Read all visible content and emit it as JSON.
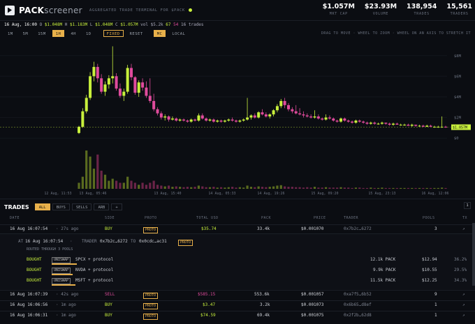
{
  "header": {
    "brand_bold": "PACK",
    "brand_light": "screener",
    "tagline": "AGGREGATED TRADE TERMINAL FOR $PACK",
    "stats": [
      {
        "value": "$1.057M",
        "label": "MKT CAP"
      },
      {
        "value": "$23.93M",
        "label": "VOLUME"
      },
      {
        "value": "138,954",
        "label": "TRADES"
      },
      {
        "value": "15,561",
        "label": "TRADERS"
      }
    ]
  },
  "ohlc": {
    "date": "16 Aug, 16:00",
    "o": "$1.048M",
    "h": "$1.183M",
    "l": "$1.048M",
    "c": "$1.057M",
    "vol": "vol $5.2k",
    "buys": "67",
    "sells": "54",
    "trades": "16 trades"
  },
  "toolbar": {
    "intervals": [
      "1M",
      "5M",
      "15M",
      "1H",
      "4H",
      "1D"
    ],
    "selected_interval": "1H",
    "fixed": "FIXED",
    "reset": "RESET",
    "mc": "MC",
    "local": "LOCAL",
    "hint": "DRAG TO MOVE · WHEEL TO ZOOM · WHEEL ON AN AXIS TO STRETCH IT"
  },
  "chart_data": {
    "type": "candlestick",
    "y_ticks": [
      "$8M",
      "$6M",
      "$4M",
      "$2M",
      "$0"
    ],
    "y_tick_values": [
      8,
      6,
      4,
      2,
      0
    ],
    "ylim": [
      -1.2,
      9.2
    ],
    "last_price_label": "$1.057M",
    "last_price": 1.06,
    "x_ticks": [
      "12 Aug, 11:53",
      "13 Aug, 05:46",
      "13 Aug, 15:40",
      "14 Aug, 05:33",
      "14 Aug, 19:26",
      "15 Aug, 09:20",
      "15 Aug, 23:13",
      "16 Aug, 12:06"
    ],
    "ohlc": [
      [
        0.5,
        1.2,
        0.4,
        1.1
      ],
      [
        1.1,
        2.9,
        1.0,
        2.6
      ],
      [
        2.6,
        4.2,
        2.4,
        3.9
      ],
      [
        3.9,
        6.4,
        3.7,
        6.0
      ],
      [
        6.0,
        7.4,
        5.5,
        6.9
      ],
      [
        6.9,
        7.2,
        5.4,
        5.8
      ],
      [
        5.8,
        6.2,
        4.3,
        4.5
      ],
      [
        4.5,
        5.5,
        4.1,
        5.2
      ],
      [
        5.2,
        6.1,
        4.8,
        5.8
      ],
      [
        5.8,
        8.9,
        5.3,
        6.0
      ],
      [
        6.0,
        6.3,
        4.6,
        4.8
      ],
      [
        4.8,
        5.3,
        3.9,
        4.1
      ],
      [
        4.1,
        4.8,
        3.6,
        4.5
      ],
      [
        4.5,
        7.1,
        4.3,
        6.8
      ],
      [
        6.8,
        7.2,
        5.6,
        5.9
      ],
      [
        5.9,
        6.0,
        4.2,
        4.4
      ],
      [
        4.4,
        5.6,
        4.0,
        5.4
      ],
      [
        5.4,
        5.8,
        4.6,
        4.9
      ],
      [
        4.9,
        5.5,
        3.9,
        4.1
      ],
      [
        4.1,
        5.8,
        3.4,
        3.6
      ],
      [
        3.6,
        4.3,
        2.6,
        2.8
      ],
      [
        2.8,
        3.0,
        2.2,
        2.4
      ],
      [
        2.4,
        2.6,
        1.8,
        2.0
      ],
      [
        2.0,
        2.3,
        1.7,
        2.1
      ],
      [
        2.1,
        2.2,
        1.6,
        1.8
      ],
      [
        1.8,
        2.1,
        1.7,
        1.9
      ],
      [
        1.9,
        2.0,
        1.6,
        1.7
      ],
      [
        1.7,
        1.9,
        1.6,
        1.8
      ],
      [
        1.8,
        1.9,
        1.6,
        1.7
      ],
      [
        1.7,
        1.8,
        1.5,
        1.6
      ],
      [
        1.6,
        1.9,
        1.5,
        1.8
      ],
      [
        1.8,
        1.9,
        1.6,
        1.7
      ],
      [
        1.7,
        2.4,
        1.6,
        2.2
      ],
      [
        2.2,
        2.4,
        1.8,
        1.9
      ],
      [
        1.9,
        2.0,
        1.6,
        1.7
      ],
      [
        1.7,
        1.9,
        1.6,
        1.8
      ],
      [
        1.8,
        1.9,
        1.5,
        1.6
      ],
      [
        1.6,
        1.8,
        1.5,
        1.7
      ],
      [
        1.7,
        1.8,
        1.5,
        1.6
      ],
      [
        1.6,
        1.8,
        1.5,
        1.7
      ],
      [
        1.7,
        1.9,
        1.6,
        1.8
      ],
      [
        1.8,
        2.0,
        1.6,
        1.7
      ],
      [
        1.7,
        1.8,
        1.5,
        1.6
      ],
      [
        1.6,
        1.8,
        1.5,
        1.7
      ],
      [
        1.7,
        1.9,
        1.6,
        1.8
      ],
      [
        1.8,
        3.9,
        1.7,
        2.0
      ],
      [
        2.0,
        2.3,
        1.8,
        2.2
      ],
      [
        2.2,
        2.4,
        1.9,
        2.0
      ],
      [
        2.0,
        2.6,
        1.9,
        2.5
      ],
      [
        2.5,
        2.8,
        2.2,
        2.3
      ],
      [
        2.3,
        2.5,
        2.0,
        2.1
      ],
      [
        2.1,
        2.4,
        1.9,
        2.3
      ],
      [
        2.3,
        2.8,
        2.1,
        2.7
      ],
      [
        2.7,
        3.3,
        2.5,
        3.1
      ],
      [
        3.1,
        3.8,
        2.9,
        3.6
      ],
      [
        3.6,
        3.9,
        2.9,
        3.2
      ],
      [
        3.2,
        3.4,
        2.6,
        2.8
      ],
      [
        2.8,
        3.0,
        2.4,
        2.6
      ],
      [
        2.6,
        3.2,
        2.3,
        2.4
      ],
      [
        2.4,
        2.9,
        2.2,
        2.3
      ],
      [
        2.3,
        2.6,
        2.0,
        2.2
      ],
      [
        2.2,
        2.4,
        2.0,
        2.1
      ],
      [
        2.1,
        2.3,
        1.9,
        2.0
      ],
      [
        2.0,
        2.7,
        1.9,
        2.1
      ],
      [
        2.1,
        2.3,
        1.8,
        1.9
      ],
      [
        1.9,
        2.0,
        1.7,
        1.8
      ],
      [
        1.8,
        2.3,
        1.7,
        2.0
      ],
      [
        2.0,
        2.2,
        1.8,
        1.9
      ],
      [
        1.9,
        2.0,
        1.6,
        1.7
      ],
      [
        1.7,
        1.8,
        1.5,
        1.6
      ],
      [
        1.6,
        2.0,
        1.5,
        1.9
      ],
      [
        1.9,
        2.0,
        1.6,
        1.7
      ],
      [
        1.7,
        1.8,
        1.5,
        1.6
      ],
      [
        1.6,
        1.7,
        1.4,
        1.5
      ],
      [
        1.5,
        1.8,
        1.4,
        1.7
      ],
      [
        1.7,
        1.8,
        1.5,
        1.6
      ],
      [
        1.6,
        1.7,
        1.4,
        1.5
      ],
      [
        1.5,
        1.6,
        1.3,
        1.4
      ],
      [
        1.4,
        1.6,
        1.3,
        1.5
      ],
      [
        1.5,
        1.6,
        1.3,
        1.4
      ],
      [
        1.4,
        1.5,
        1.3,
        1.4
      ],
      [
        1.4,
        1.6,
        1.3,
        1.5
      ],
      [
        1.5,
        1.5,
        1.3,
        1.4
      ],
      [
        1.4,
        1.5,
        1.2,
        1.3
      ],
      [
        1.3,
        1.5,
        1.2,
        1.4
      ],
      [
        1.4,
        1.5,
        1.3,
        1.3
      ],
      [
        1.3,
        1.4,
        1.2,
        1.3
      ],
      [
        1.3,
        1.4,
        1.2,
        1.3
      ],
      [
        1.3,
        1.4,
        1.2,
        1.2
      ],
      [
        1.2,
        1.4,
        1.1,
        1.3
      ],
      [
        1.3,
        1.3,
        1.1,
        1.2
      ],
      [
        1.2,
        1.3,
        1.1,
        1.2
      ],
      [
        1.2,
        1.3,
        1.1,
        1.1
      ],
      [
        1.1,
        1.3,
        1.1,
        1.2
      ],
      [
        1.2,
        1.3,
        1.1,
        1.1
      ],
      [
        1.1,
        1.2,
        1.0,
        1.1
      ],
      [
        1.1,
        1.2,
        1.0,
        1.1
      ],
      [
        1.1,
        2.1,
        1.0,
        1.1
      ],
      [
        1.1,
        1.2,
        1.0,
        1.06
      ]
    ],
    "volume": [
      1.5,
      3.0,
      9.5,
      8.0,
      5.0,
      8.5,
      4.5,
      3.5,
      2.0,
      2.5,
      2.0,
      1.5,
      1.5,
      3.0,
      2.0,
      1.5,
      1.0,
      1.5,
      1.0,
      1.5,
      2.0,
      1.0,
      0.8,
      0.6,
      0.8,
      0.5,
      0.6,
      0.5,
      0.4,
      0.5,
      0.4,
      0.5,
      0.8,
      0.6,
      0.4,
      0.4,
      0.5,
      0.3,
      0.4,
      0.3,
      0.4,
      0.5,
      0.3,
      0.4,
      0.3,
      0.8,
      0.5,
      0.4,
      0.6,
      0.5,
      0.4,
      0.5,
      0.6,
      0.8,
      0.9,
      0.6,
      0.5,
      0.5,
      0.4,
      0.4,
      0.3,
      0.4,
      0.3,
      0.5,
      0.3,
      0.3,
      0.4,
      0.3,
      0.3,
      0.3,
      0.4,
      0.3,
      0.3,
      0.2,
      0.3,
      0.3,
      0.2,
      0.2,
      0.3,
      0.2,
      0.2,
      0.3,
      0.2,
      0.2,
      0.2,
      0.2,
      0.2,
      0.2,
      0.2,
      0.2,
      0.2,
      0.2,
      0.2,
      0.2,
      0.2,
      0.2,
      0.2,
      0.3,
      0.2
    ]
  },
  "trades": {
    "title": "TRADES",
    "tabs": [
      "ALL",
      "BUYS",
      "SELLS",
      "ARB",
      "+"
    ],
    "page": "1",
    "columns": [
      "DATE",
      "SIDE",
      "PROTO",
      "TOTAL USD",
      "PACK",
      "PRICE",
      "TRADER",
      "POOLS",
      "TX"
    ],
    "rows": [
      {
        "date": "16 Aug 16:07:54",
        "ago": "· 27s ago",
        "side": "BUY",
        "proto": "PROTO",
        "usd": "$35.74",
        "pack": "33.4k",
        "price": "$0.001070",
        "trader": "0x7b2c…6272",
        "pools": "3",
        "tx": "↗"
      },
      {
        "date": "16 Aug 16:07:39",
        "ago": "· 42s ago",
        "side": "SELL",
        "proto": "PROTO",
        "usd": "$585.15",
        "pack": "553.6k",
        "price": "$0.001057",
        "trader": "0xa7f5…6b52",
        "pools": "9",
        "tx": "↗"
      },
      {
        "date": "16 Aug 16:06:56",
        "ago": "· 1m ago",
        "side": "BUY",
        "proto": "PROTO",
        "usd": "$3.47",
        "pack": "3.2k",
        "price": "$0.001073",
        "trader": "0x6b65…d8ef",
        "pools": "1",
        "tx": "↗"
      },
      {
        "date": "16 Aug 16:06:31",
        "ago": "· 1m ago",
        "side": "BUY",
        "proto": "PROTO",
        "usd": "$74.59",
        "pack": "69.4k",
        "price": "$0.001075",
        "trader": "0x2f2b…62d8",
        "pools": "1",
        "tx": "↗"
      }
    ],
    "detail": {
      "at": "AT",
      "date": "16 Aug 16:07:54",
      "trader_label": "TRADER",
      "trader": "0x7b2c…6272",
      "to": "TO",
      "to_addr": "0x0cdc…ac31",
      "proto": "PROTO",
      "routed": "ROUTED THROUGH 3 POOLS",
      "legs": [
        {
          "side": "BOUGHT",
          "venue": "UNISWAP",
          "asset": "SPCX + protocol",
          "pack": "12.1k PACK",
          "usd": "$12.94",
          "pct": "36.2%"
        },
        {
          "side": "BOUGHT",
          "venue": "UNISWAP",
          "asset": "NVDA + protocol",
          "pack": "9.9k PACK",
          "usd": "$10.55",
          "pct": "29.5%"
        },
        {
          "side": "BOUGHT",
          "venue": "UNISWAP",
          "asset": "MSFT + protocol",
          "pack": "11.5k PACK",
          "usd": "$12.25",
          "pct": "34.3%"
        }
      ]
    }
  }
}
